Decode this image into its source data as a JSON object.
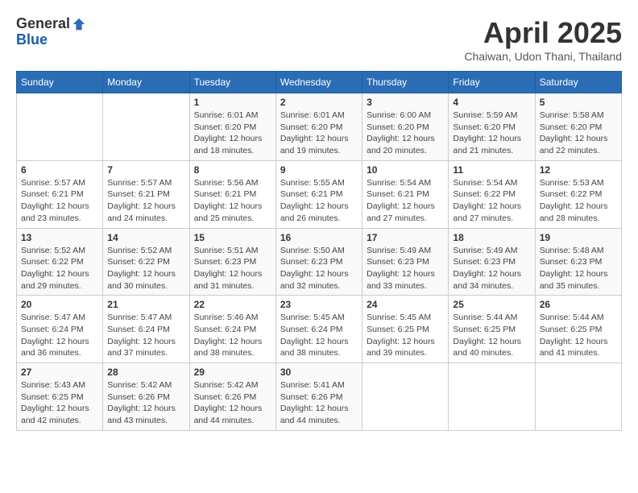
{
  "header": {
    "logo_general": "General",
    "logo_blue": "Blue",
    "title": "April 2025",
    "location": "Chaiwan, Udon Thani, Thailand"
  },
  "weekdays": [
    "Sunday",
    "Monday",
    "Tuesday",
    "Wednesday",
    "Thursday",
    "Friday",
    "Saturday"
  ],
  "weeks": [
    [
      {
        "day": "",
        "info": ""
      },
      {
        "day": "",
        "info": ""
      },
      {
        "day": "1",
        "info": "Sunrise: 6:01 AM\nSunset: 6:20 PM\nDaylight: 12 hours\nand 18 minutes."
      },
      {
        "day": "2",
        "info": "Sunrise: 6:01 AM\nSunset: 6:20 PM\nDaylight: 12 hours\nand 19 minutes."
      },
      {
        "day": "3",
        "info": "Sunrise: 6:00 AM\nSunset: 6:20 PM\nDaylight: 12 hours\nand 20 minutes."
      },
      {
        "day": "4",
        "info": "Sunrise: 5:59 AM\nSunset: 6:20 PM\nDaylight: 12 hours\nand 21 minutes."
      },
      {
        "day": "5",
        "info": "Sunrise: 5:58 AM\nSunset: 6:20 PM\nDaylight: 12 hours\nand 22 minutes."
      }
    ],
    [
      {
        "day": "6",
        "info": "Sunrise: 5:57 AM\nSunset: 6:21 PM\nDaylight: 12 hours\nand 23 minutes."
      },
      {
        "day": "7",
        "info": "Sunrise: 5:57 AM\nSunset: 6:21 PM\nDaylight: 12 hours\nand 24 minutes."
      },
      {
        "day": "8",
        "info": "Sunrise: 5:56 AM\nSunset: 6:21 PM\nDaylight: 12 hours\nand 25 minutes."
      },
      {
        "day": "9",
        "info": "Sunrise: 5:55 AM\nSunset: 6:21 PM\nDaylight: 12 hours\nand 26 minutes."
      },
      {
        "day": "10",
        "info": "Sunrise: 5:54 AM\nSunset: 6:21 PM\nDaylight: 12 hours\nand 27 minutes."
      },
      {
        "day": "11",
        "info": "Sunrise: 5:54 AM\nSunset: 6:22 PM\nDaylight: 12 hours\nand 27 minutes."
      },
      {
        "day": "12",
        "info": "Sunrise: 5:53 AM\nSunset: 6:22 PM\nDaylight: 12 hours\nand 28 minutes."
      }
    ],
    [
      {
        "day": "13",
        "info": "Sunrise: 5:52 AM\nSunset: 6:22 PM\nDaylight: 12 hours\nand 29 minutes."
      },
      {
        "day": "14",
        "info": "Sunrise: 5:52 AM\nSunset: 6:22 PM\nDaylight: 12 hours\nand 30 minutes."
      },
      {
        "day": "15",
        "info": "Sunrise: 5:51 AM\nSunset: 6:23 PM\nDaylight: 12 hours\nand 31 minutes."
      },
      {
        "day": "16",
        "info": "Sunrise: 5:50 AM\nSunset: 6:23 PM\nDaylight: 12 hours\nand 32 minutes."
      },
      {
        "day": "17",
        "info": "Sunrise: 5:49 AM\nSunset: 6:23 PM\nDaylight: 12 hours\nand 33 minutes."
      },
      {
        "day": "18",
        "info": "Sunrise: 5:49 AM\nSunset: 6:23 PM\nDaylight: 12 hours\nand 34 minutes."
      },
      {
        "day": "19",
        "info": "Sunrise: 5:48 AM\nSunset: 6:23 PM\nDaylight: 12 hours\nand 35 minutes."
      }
    ],
    [
      {
        "day": "20",
        "info": "Sunrise: 5:47 AM\nSunset: 6:24 PM\nDaylight: 12 hours\nand 36 minutes."
      },
      {
        "day": "21",
        "info": "Sunrise: 5:47 AM\nSunset: 6:24 PM\nDaylight: 12 hours\nand 37 minutes."
      },
      {
        "day": "22",
        "info": "Sunrise: 5:46 AM\nSunset: 6:24 PM\nDaylight: 12 hours\nand 38 minutes."
      },
      {
        "day": "23",
        "info": "Sunrise: 5:45 AM\nSunset: 6:24 PM\nDaylight: 12 hours\nand 38 minutes."
      },
      {
        "day": "24",
        "info": "Sunrise: 5:45 AM\nSunset: 6:25 PM\nDaylight: 12 hours\nand 39 minutes."
      },
      {
        "day": "25",
        "info": "Sunrise: 5:44 AM\nSunset: 6:25 PM\nDaylight: 12 hours\nand 40 minutes."
      },
      {
        "day": "26",
        "info": "Sunrise: 5:44 AM\nSunset: 6:25 PM\nDaylight: 12 hours\nand 41 minutes."
      }
    ],
    [
      {
        "day": "27",
        "info": "Sunrise: 5:43 AM\nSunset: 6:25 PM\nDaylight: 12 hours\nand 42 minutes."
      },
      {
        "day": "28",
        "info": "Sunrise: 5:42 AM\nSunset: 6:26 PM\nDaylight: 12 hours\nand 43 minutes."
      },
      {
        "day": "29",
        "info": "Sunrise: 5:42 AM\nSunset: 6:26 PM\nDaylight: 12 hours\nand 44 minutes."
      },
      {
        "day": "30",
        "info": "Sunrise: 5:41 AM\nSunset: 6:26 PM\nDaylight: 12 hours\nand 44 minutes."
      },
      {
        "day": "",
        "info": ""
      },
      {
        "day": "",
        "info": ""
      },
      {
        "day": "",
        "info": ""
      }
    ]
  ]
}
